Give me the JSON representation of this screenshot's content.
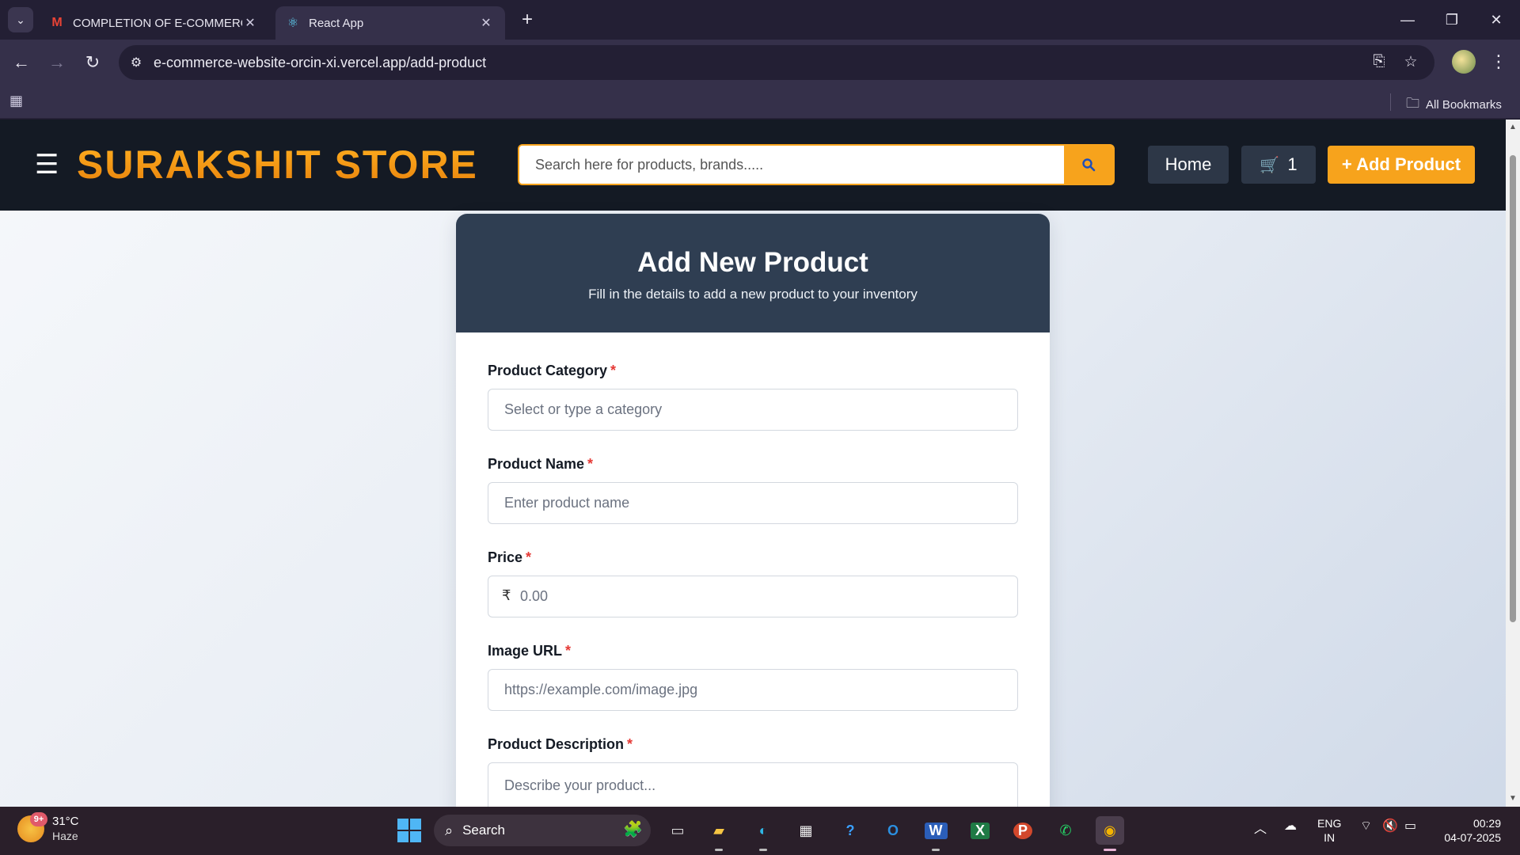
{
  "browser": {
    "tabs": [
      {
        "title": "COMPLETION OF E-COMMERCE",
        "icon": "gmail-icon",
        "active": false
      },
      {
        "title": "React App",
        "icon": "react-icon",
        "active": true
      }
    ],
    "url": "e-commerce-website-orcin-xi.vercel.app/add-product",
    "bookmarks_label": "All Bookmarks"
  },
  "site": {
    "brand": "SURAKSHIT STORE",
    "search_placeholder": "Search here for products, brands.....",
    "nav": {
      "home": "Home",
      "cart_count": "1",
      "add_product": "+ Add Product"
    }
  },
  "form": {
    "title": "Add New Product",
    "subtitle": "Fill in the details to add a new product to your inventory",
    "required_marker": "*",
    "currency_symbol": "₹",
    "fields": [
      {
        "label": "Product Category",
        "placeholder": "Select or type a category",
        "type": "text"
      },
      {
        "label": "Product Name",
        "placeholder": "Enter product name",
        "type": "text"
      },
      {
        "label": "Price",
        "placeholder": "0.00",
        "type": "price"
      },
      {
        "label": "Image URL",
        "placeholder": "https://example.com/image.jpg",
        "type": "text"
      },
      {
        "label": "Product Description",
        "placeholder": "Describe your product...",
        "type": "textarea"
      }
    ]
  },
  "taskbar": {
    "weather": {
      "temp": "31°C",
      "condition": "Haze",
      "badge": "9+"
    },
    "search_label": "Search",
    "language": {
      "line1": "ENG",
      "line2": "IN"
    },
    "clock": {
      "time": "00:29",
      "date": "04-07-2025"
    }
  },
  "colors": {
    "brand_orange": "#f7a31c",
    "header_dark": "#141a24",
    "card_head": "#2f3e52",
    "required_red": "#e53935"
  }
}
